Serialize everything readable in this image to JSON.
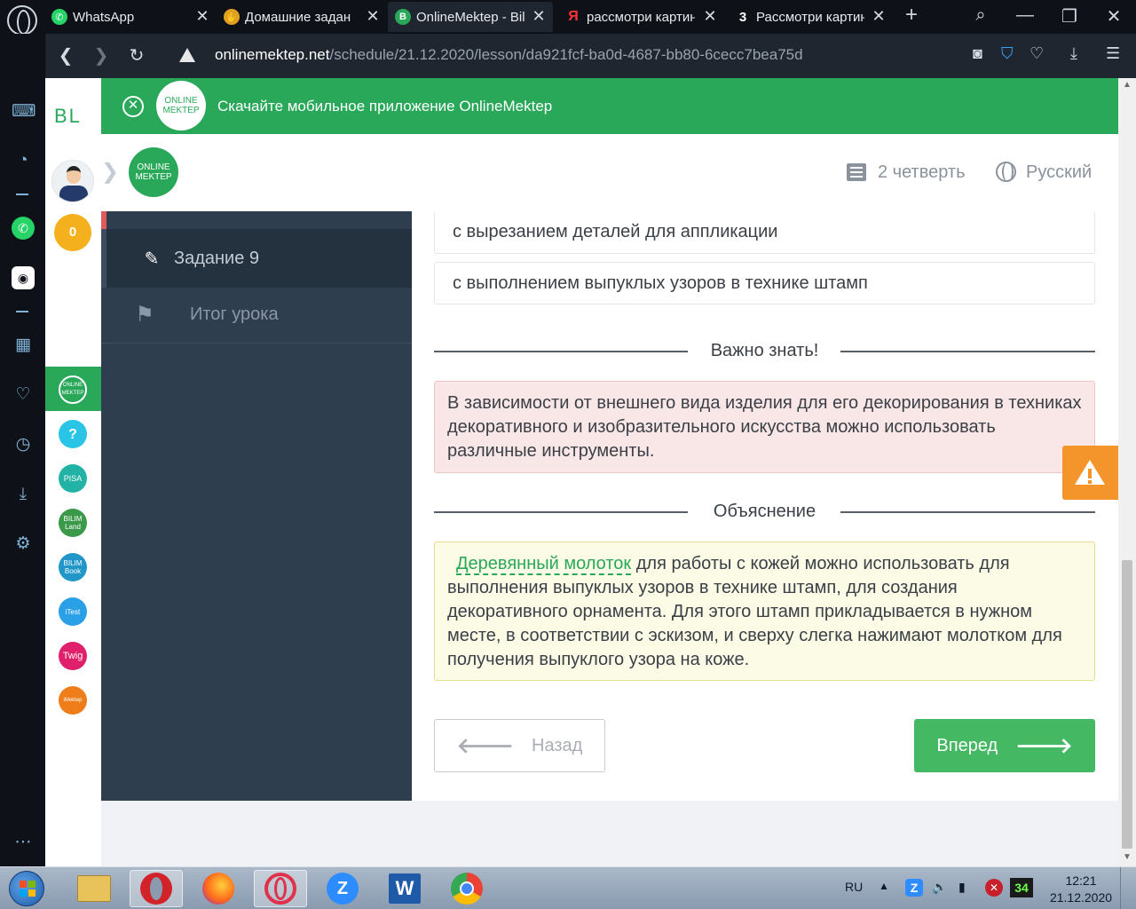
{
  "browser": {
    "tabs": [
      {
        "label": "WhatsApp",
        "favicon": "whatsapp-icon",
        "color": "#25d366",
        "active": false
      },
      {
        "label": "Домашние задани",
        "favicon": "hand-icon",
        "color": "#e0a020",
        "active": false
      },
      {
        "label": "OnlineMektep - Bil",
        "favicon": "b-icon",
        "color": "#2aa85a",
        "active": true
      },
      {
        "label": "рассмотри картин",
        "favicon": "yandex-icon",
        "color": "#ff3333",
        "active": false
      },
      {
        "label": "Рассмотри картин",
        "favicon": "z-icon",
        "color": "#111111",
        "active": false
      }
    ],
    "url_host": "onlinemektep.net",
    "url_path": "/schedule/21.12.2020/lesson/da921fcf-ba0d-4687-bb80-6cecc7bea75d"
  },
  "banner": {
    "logo_text": "ONLINE MEKTEP",
    "text": "Скачайте мобильное приложение OnlineMektep"
  },
  "site_sidebar": {
    "logo": "BL",
    "coins": "0",
    "apps": [
      {
        "name": "onlinemektep-app-icon",
        "label": "ONLINE MEKTEP",
        "color": "#2aa85a"
      },
      {
        "name": "help-app-icon",
        "label": "?",
        "color": "#29c4e6"
      },
      {
        "name": "pisa-app-icon",
        "label": "PISA",
        "color": "#22b3a6"
      },
      {
        "name": "bilimland-app-icon",
        "label": "BILIM Land",
        "color": "#3a9a4a"
      },
      {
        "name": "bilimbook-app-icon",
        "label": "BILIM Book",
        "color": "#2196c9"
      },
      {
        "name": "itest-app-icon",
        "label": "iTest",
        "color": "#2aa0e6"
      },
      {
        "name": "twig-app-icon",
        "label": "Twig",
        "color": "#e0206a"
      },
      {
        "name": "imektep-app-icon",
        "label": "iMektep",
        "color": "#ee7d1a"
      }
    ]
  },
  "header": {
    "logo_text": "ONLINE MEKTEP",
    "quarter": "2 четверть",
    "language": "Русский"
  },
  "lesson_nav": {
    "items": [
      {
        "label": "Задание 9",
        "icon": "edit-icon"
      },
      {
        "label": "Итог урока",
        "icon": "flag-icon"
      }
    ]
  },
  "content": {
    "options": [
      "с вырезанием деталей для аппликации",
      "с выполнением выпуклых узоров в технике штамп"
    ],
    "important_title": "Важно знать!",
    "important_text": "В зависимости от внешнего вида изделия для его декорирования в техниках декоративного и изобразительного искусства можно использовать различные инструменты.",
    "explain_title": "Объяснение",
    "explain_term": "Деревянный молоток",
    "explain_text": " для работы с кожей можно использовать для выполнения выпуклых узоров в технике штамп, для создания декоративного орнамента. Для этого штамп прикладывается в нужном месте, в соответствии с эскизом, и сверху слегка нажимают молотком для получения выпуклого узора на коже.",
    "back_label": "Назад",
    "next_label": "Вперед"
  },
  "taskbar": {
    "language": "RU",
    "badge": "34",
    "time": "12:21",
    "date": "21.12.2020"
  }
}
